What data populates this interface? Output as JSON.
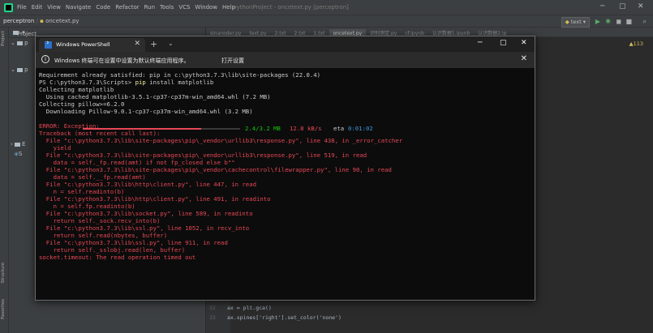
{
  "ide": {
    "menu": [
      "File",
      "Edit",
      "View",
      "Navigate",
      "Code",
      "Refactor",
      "Run",
      "Tools",
      "VCS",
      "Window",
      "Help"
    ],
    "title": "pythonProject - oncetext.py [perceptron]",
    "breadcrumb_project": "perceptron",
    "breadcrumb_file": "oncetext.py",
    "run_config": "text",
    "side_tabs": {
      "project": "Project",
      "structure": "Structure",
      "favorites": "Favorites"
    },
    "project_header": "Project",
    "tree_labels": [
      "p",
      "p",
      "E",
      "S"
    ],
    "editor_tabs": [
      "sinanoder.py",
      "text.py",
      "2.txt",
      "2.txt",
      "1.txt",
      "oncetext.py",
      "识别测定.py",
      "cf.ipynb",
      "认识数据1.ipynb",
      "认识数据2.ip"
    ],
    "active_tab_index": 5,
    "inspection": "▲113",
    "code": [
      {
        "ln": "32",
        "text": "ax = plt.gca()"
      },
      {
        "ln": "33",
        "text": "ax.spines['right'].set_color('none')"
      }
    ]
  },
  "ps": {
    "tab_title": "Windows PowerShell",
    "info_message": "Windows 终端可在设置中设置为默认终端应用程序。",
    "info_button": "打开设置",
    "lines": [
      {
        "t": "Requirement already satisfied: pip in c:\\python3.7.3\\lib\\site-packages (22.0.4)",
        "c": "n"
      },
      {
        "t": "PS C:\\python3.7.3\\Scripts> pip install matplotlib",
        "c": "prompt"
      },
      {
        "t": "Collecting matplotlib",
        "c": "n"
      },
      {
        "t": "  Using cached matplotlib-3.5.1-cp37-cp37m-win_amd64.whl (7.2 MB)",
        "c": "n"
      },
      {
        "t": "Collecting pillow>=6.2.0",
        "c": "n"
      },
      {
        "t": "  Downloading Pillow-9.0.1-cp37-cp37m-win_amd64.whl (3.2 MB)",
        "c": "n"
      },
      {
        "t": "",
        "c": "progress"
      },
      {
        "t": "ERROR: Exception:",
        "c": "err"
      },
      {
        "t": "Traceback (most recent call last):",
        "c": "err"
      },
      {
        "t": "  File \"c:\\python3.7.3\\lib\\site-packages\\pip\\_vendor\\urllib3\\response.py\", line 438, in _error_catcher",
        "c": "err"
      },
      {
        "t": "    yield",
        "c": "err"
      },
      {
        "t": "  File \"c:\\python3.7.3\\lib\\site-packages\\pip\\_vendor\\urllib3\\response.py\", line 519, in read",
        "c": "err"
      },
      {
        "t": "    data = self._fp.read(amt) if not fp_closed else b\"\"",
        "c": "err"
      },
      {
        "t": "  File \"c:\\python3.7.3\\lib\\site-packages\\pip\\_vendor\\cachecontrol\\filewrapper.py\", line 90, in read",
        "c": "err"
      },
      {
        "t": "    data = self.__fp.read(amt)",
        "c": "err"
      },
      {
        "t": "  File \"c:\\python3.7.3\\lib\\http\\client.py\", line 447, in read",
        "c": "err"
      },
      {
        "t": "    n = self.readinto(b)",
        "c": "err"
      },
      {
        "t": "  File \"c:\\python3.7.3\\lib\\http\\client.py\", line 491, in readinto",
        "c": "err"
      },
      {
        "t": "    n = self.fp.readinto(b)",
        "c": "err"
      },
      {
        "t": "  File \"c:\\python3.7.3\\lib\\socket.py\", line 589, in readinto",
        "c": "err"
      },
      {
        "t": "    return self._sock.recv_into(b)",
        "c": "err"
      },
      {
        "t": "  File \"c:\\python3.7.3\\lib\\ssl.py\", line 1052, in recv_into",
        "c": "err"
      },
      {
        "t": "    return self.read(nbytes, buffer)",
        "c": "err"
      },
      {
        "t": "  File \"c:\\python3.7.3\\lib\\ssl.py\", line 911, in read",
        "c": "err"
      },
      {
        "t": "    return self._sslobj.read(len, buffer)",
        "c": "err"
      },
      {
        "t": "socket.timeout: The read operation timed out",
        "c": "err"
      }
    ],
    "prompt_prefix": "PS C:\\python3.7.3\\Scripts> ",
    "prompt_cmd": "pip",
    "prompt_args": " install matplotlib",
    "progress": {
      "fraction": 0.75,
      "size": "2.4/3.2 MB",
      "speed": "12.8 kB/s",
      "eta_label": "eta",
      "eta": "0:01:02"
    },
    "colors": {
      "error": "#e74856",
      "size": "#16c60c",
      "speed": "#e74856",
      "eta": "#3a96dd",
      "highlight": "#f9f1a5"
    }
  }
}
